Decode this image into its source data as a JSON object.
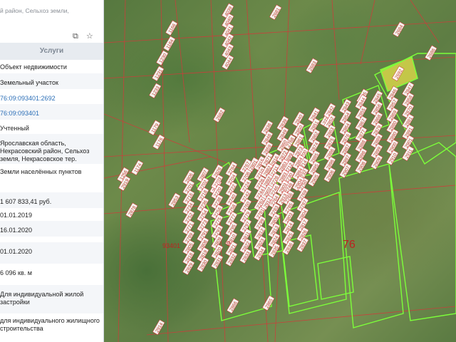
{
  "panel": {
    "address_top": "й район, Сельхоз земли,",
    "header": "Услуги",
    "rows": [
      {
        "text": "Объект недвижимости",
        "link": false
      },
      {
        "text": "Земельный участок",
        "link": false
      },
      {
        "text": "76:09:093401:2692",
        "link": true
      },
      {
        "text": "76:09:093401",
        "link": true
      },
      {
        "text": "Учтенный",
        "link": false
      },
      {
        "text": "Ярославская область, Некрасовский район, Сельхоз земля, Некрасовское тер.",
        "link": false
      },
      {
        "text": "Земли населённых пунктов",
        "link": false
      },
      {
        "text": "1 607 833,41 руб.",
        "link": false
      },
      {
        "text": "01.01.2019",
        "link": false
      },
      {
        "text": "16.01.2020",
        "link": false
      },
      {
        "text": "01.01.2020",
        "link": false
      },
      {
        "text": "6 096 кв. м",
        "link": false
      },
      {
        "text": "Для индивидуальной жилой застройки",
        "link": false
      },
      {
        "text": "для индивидуального жилищного строительства",
        "link": false
      }
    ],
    "icons": [
      "copy-icon",
      "star-icon"
    ]
  },
  "map": {
    "block_labels": [
      "76",
      "93401",
      "9"
    ],
    "parcels": [
      {
        "n": "4039"
      },
      {
        "n": "4040"
      },
      {
        "n": "4041"
      },
      {
        "n": "4042"
      },
      {
        "n": "4043"
      },
      {
        "n": "4044"
      },
      {
        "n": "1166"
      },
      {
        "n": "1184"
      },
      {
        "n": "1230"
      },
      {
        "n": "1231"
      },
      {
        "n": "1233"
      },
      {
        "n": "1179"
      },
      {
        "n": "1176"
      },
      {
        "n": "1174"
      },
      {
        "n": "1256"
      },
      {
        "n": "2919"
      },
      {
        "n": "2681"
      },
      {
        "n": "2683"
      },
      {
        "n": "2682"
      },
      {
        "n": "2684"
      },
      {
        "n": "2686"
      },
      {
        "n": "2692"
      },
      {
        "n": "2705"
      },
      {
        "n": "2713"
      },
      {
        "n": "2768"
      },
      {
        "n": "2801"
      },
      {
        "n": "2827"
      },
      {
        "n": "2853"
      },
      {
        "n": "2878"
      },
      {
        "n": "2865"
      },
      {
        "n": "2866"
      },
      {
        "n": "2914"
      },
      {
        "n": "2806"
      },
      {
        "n": "2807"
      },
      {
        "n": "2828"
      },
      {
        "n": "2784"
      },
      {
        "n": "2767"
      },
      {
        "n": "2815"
      },
      {
        "n": "2816"
      },
      {
        "n": "2699"
      },
      {
        "n": "2700"
      },
      {
        "n": "2701"
      },
      {
        "n": "2702"
      },
      {
        "n": "2703"
      },
      {
        "n": "2704"
      },
      {
        "n": "2706"
      },
      {
        "n": "2710"
      },
      {
        "n": "2711"
      },
      {
        "n": "2712"
      },
      {
        "n": "2714"
      },
      {
        "n": "2716"
      },
      {
        "n": "2718"
      },
      {
        "n": "2720"
      },
      {
        "n": "2722"
      },
      {
        "n": "2724"
      },
      {
        "n": "2726"
      },
      {
        "n": "2728"
      },
      {
        "n": "2730"
      },
      {
        "n": "2732"
      },
      {
        "n": "2734"
      },
      {
        "n": "2736"
      },
      {
        "n": "2738"
      },
      {
        "n": "2740"
      },
      {
        "n": "2742"
      },
      {
        "n": "2744"
      },
      {
        "n": "2746"
      },
      {
        "n": "2748"
      },
      {
        "n": "2750"
      },
      {
        "n": "2752"
      },
      {
        "n": "2754"
      },
      {
        "n": "2756"
      },
      {
        "n": "2758"
      },
      {
        "n": "2760"
      },
      {
        "n": "2762"
      },
      {
        "n": "2764"
      },
      {
        "n": "2766"
      },
      {
        "n": "2769"
      },
      {
        "n": "2771"
      },
      {
        "n": "2773"
      },
      {
        "n": "2775"
      },
      {
        "n": "2777"
      },
      {
        "n": "2779"
      },
      {
        "n": "2781"
      },
      {
        "n": "2783"
      },
      {
        "n": "2785"
      },
      {
        "n": "2787"
      },
      {
        "n": "2789"
      },
      {
        "n": "2791"
      },
      {
        "n": "2793"
      },
      {
        "n": "2795"
      },
      {
        "n": "2797"
      },
      {
        "n": "2799"
      },
      {
        "n": "2802"
      },
      {
        "n": "2803"
      },
      {
        "n": "2804"
      },
      {
        "n": "2805"
      },
      {
        "n": "2808"
      },
      {
        "n": "2809"
      },
      {
        "n": "2810"
      },
      {
        "n": "2811"
      },
      {
        "n": "2812"
      },
      {
        "n": "2813"
      },
      {
        "n": "2814"
      },
      {
        "n": "2817"
      },
      {
        "n": "2818"
      },
      {
        "n": "2819"
      },
      {
        "n": "2820"
      },
      {
        "n": "2821"
      },
      {
        "n": "2822"
      },
      {
        "n": "2823"
      },
      {
        "n": "2824"
      },
      {
        "n": "2825"
      },
      {
        "n": "2826"
      },
      {
        "n": "2829"
      },
      {
        "n": "2830"
      },
      {
        "n": "2831"
      },
      {
        "n": "2832"
      },
      {
        "n": "2833"
      },
      {
        "n": "2834"
      },
      {
        "n": "2835"
      },
      {
        "n": "2836"
      },
      {
        "n": "2837"
      },
      {
        "n": "2838"
      },
      {
        "n": "2839"
      },
      {
        "n": "2840"
      },
      {
        "n": "2841"
      },
      {
        "n": "2842"
      },
      {
        "n": "2843"
      },
      {
        "n": "2844"
      },
      {
        "n": "2845"
      },
      {
        "n": "2846"
      },
      {
        "n": "2847"
      },
      {
        "n": "2848"
      },
      {
        "n": "2849"
      },
      {
        "n": "2850"
      },
      {
        "n": "2851"
      },
      {
        "n": "2852"
      },
      {
        "n": "2854"
      },
      {
        "n": "2855"
      },
      {
        "n": "2856"
      },
      {
        "n": "2857"
      },
      {
        "n": "2858"
      },
      {
        "n": "2859"
      },
      {
        "n": "2860"
      },
      {
        "n": "2861"
      },
      {
        "n": "2862"
      },
      {
        "n": "2863"
      },
      {
        "n": "2864"
      },
      {
        "n": "2867"
      },
      {
        "n": "2868"
      },
      {
        "n": "2869"
      },
      {
        "n": "2870"
      },
      {
        "n": "2871"
      },
      {
        "n": "2872"
      },
      {
        "n": "2873"
      },
      {
        "n": "2874"
      },
      {
        "n": "2875"
      },
      {
        "n": "2876"
      },
      {
        "n": "2877"
      },
      {
        "n": "2879"
      },
      {
        "n": "2880"
      },
      {
        "n": "2881"
      },
      {
        "n": "2882"
      },
      {
        "n": "2883"
      },
      {
        "n": "2884"
      },
      {
        "n": "2885"
      },
      {
        "n": "2886"
      },
      {
        "n": "2887"
      },
      {
        "n": "2888"
      },
      {
        "n": "2889"
      },
      {
        "n": "2890"
      },
      {
        "n": "2891"
      },
      {
        "n": "2892"
      },
      {
        "n": "2893"
      },
      {
        "n": "2894"
      },
      {
        "n": "2895"
      },
      {
        "n": "2896"
      },
      {
        "n": "2897"
      },
      {
        "n": "2898"
      },
      {
        "n": "2899"
      },
      {
        "n": "2900"
      },
      {
        "n": "2901"
      },
      {
        "n": "2902"
      },
      {
        "n": "2903"
      },
      {
        "n": "2904"
      },
      {
        "n": "2905"
      },
      {
        "n": "2906"
      },
      {
        "n": "2907"
      },
      {
        "n": "2908"
      },
      {
        "n": "2909"
      },
      {
        "n": "2910"
      },
      {
        "n": "2911"
      },
      {
        "n": "2912"
      },
      {
        "n": "2913"
      }
    ],
    "colors": {
      "boundary": "#d23a3a",
      "selected_outline": "#7cff3a",
      "label_bg": "#ffffff",
      "label_text": "#c0392b",
      "highlight": "#e6e04a",
      "block_label": "#c02020"
    }
  }
}
